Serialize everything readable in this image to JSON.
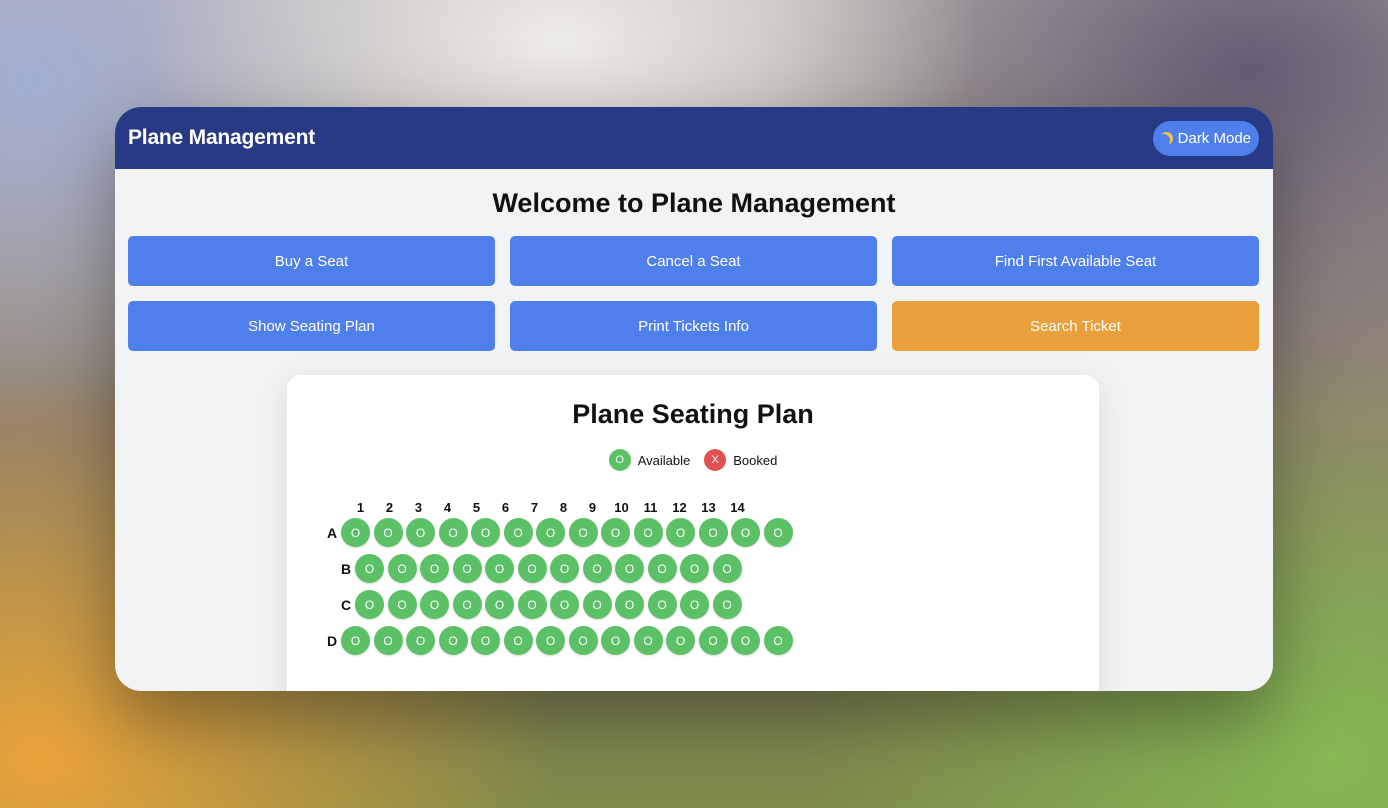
{
  "header": {
    "title": "Plane Management",
    "dark_mode_label": "Dark Mode",
    "dark_mode_icon": "moon-icon"
  },
  "welcome": "Welcome to Plane Management",
  "actions": [
    {
      "label": "Buy a Seat",
      "color": "#4f7fea"
    },
    {
      "label": "Cancel a Seat",
      "color": "#4f7fea"
    },
    {
      "label": "Find First Available Seat",
      "color": "#4f7fea"
    },
    {
      "label": "Show Seating Plan",
      "color": "#4f7fea"
    },
    {
      "label": "Print Tickets Info",
      "color": "#4f7fea"
    },
    {
      "label": "Search Ticket",
      "color": "#e9a03a"
    }
  ],
  "seating": {
    "title": "Plane Seating Plan",
    "legend": [
      {
        "symbol": "O",
        "label": "Available",
        "color": "#5cc166"
      },
      {
        "symbol": "X",
        "label": "Booked",
        "color": "#e05252"
      }
    ],
    "columns": [
      "1",
      "2",
      "3",
      "4",
      "5",
      "6",
      "7",
      "8",
      "9",
      "10",
      "11",
      "12",
      "13",
      "14"
    ],
    "rows": [
      {
        "label": "A",
        "seats": [
          "O",
          "O",
          "O",
          "O",
          "O",
          "O",
          "O",
          "O",
          "O",
          "O",
          "O",
          "O",
          "O",
          "O"
        ]
      },
      {
        "label": "B",
        "seats": [
          "O",
          "O",
          "O",
          "O",
          "O",
          "O",
          "O",
          "O",
          "O",
          "O",
          "O",
          "O"
        ]
      },
      {
        "label": "C",
        "seats": [
          "O",
          "O",
          "O",
          "O",
          "O",
          "O",
          "O",
          "O",
          "O",
          "O",
          "O",
          "O"
        ]
      },
      {
        "label": "D",
        "seats": [
          "O",
          "O",
          "O",
          "O",
          "O",
          "O",
          "O",
          "O",
          "O",
          "O",
          "O",
          "O",
          "O",
          "O"
        ]
      }
    ]
  }
}
